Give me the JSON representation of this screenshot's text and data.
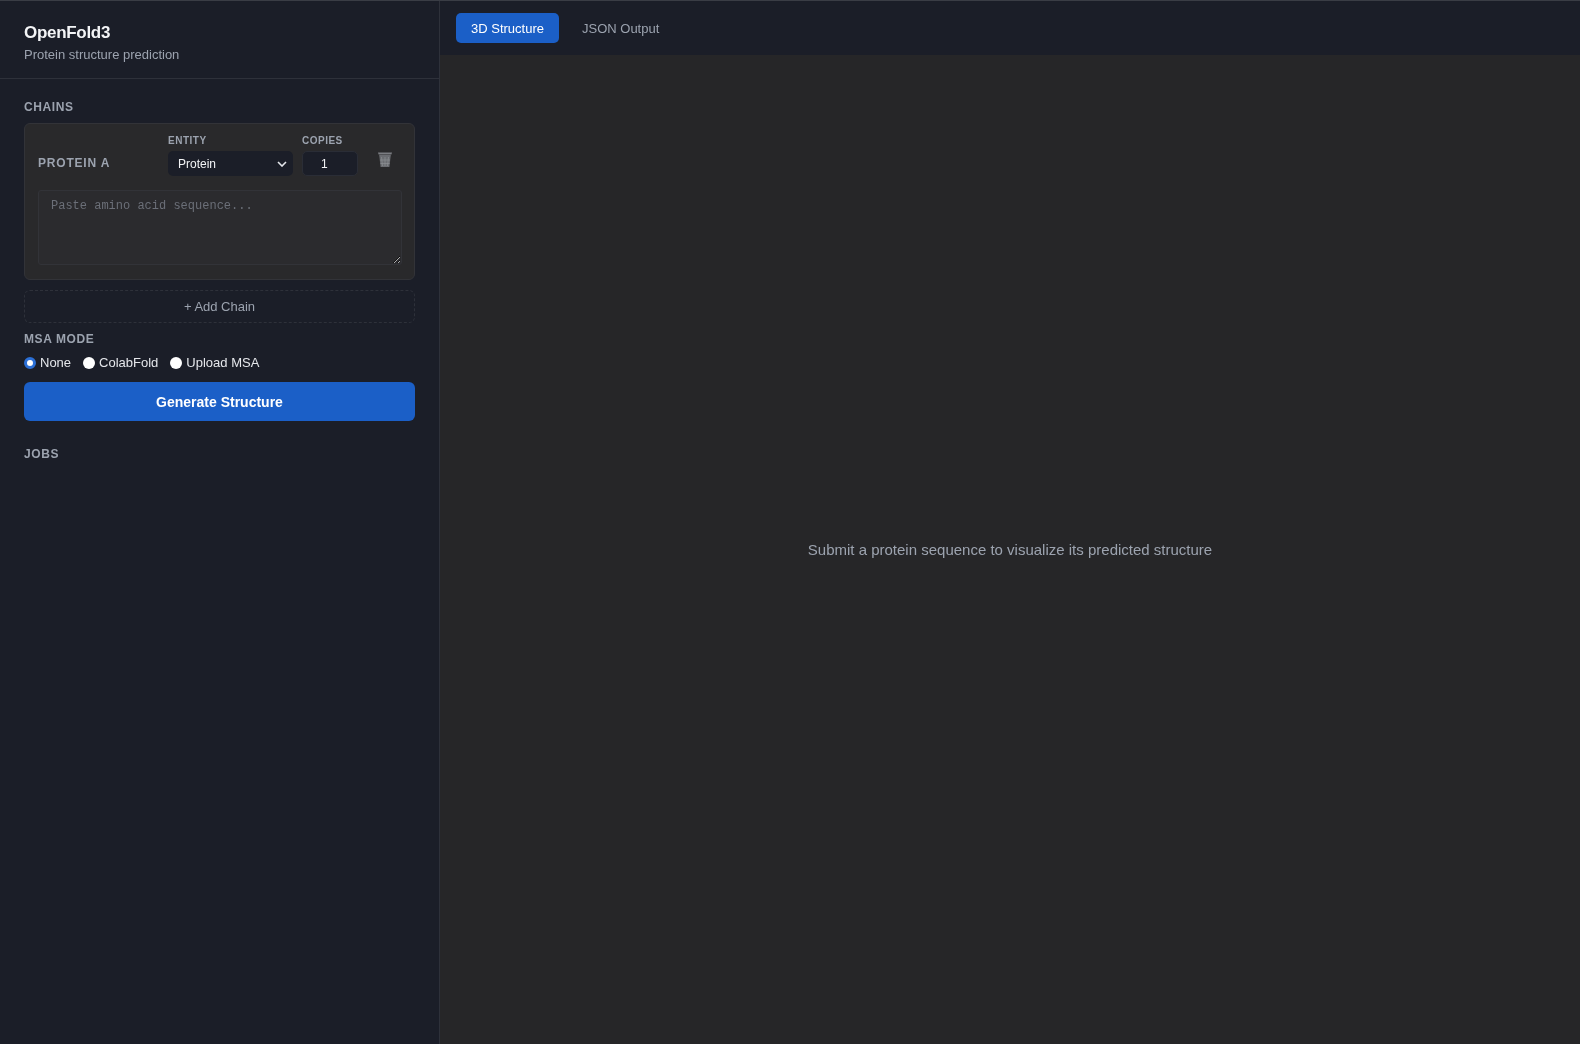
{
  "app": {
    "title": "OpenFold3",
    "subtitle": "Protein structure prediction"
  },
  "chains_section": {
    "heading": "CHAINS",
    "chains": [
      {
        "label": "PROTEIN A",
        "entity_label": "ENTITY",
        "entity_value": "Protein",
        "copies_label": "COPIES",
        "copies_value": "1",
        "sequence_placeholder": "Paste amino acid sequence..."
      }
    ],
    "add_button": "+ Add Chain"
  },
  "msa_mode": {
    "heading": "MSA MODE",
    "options": [
      {
        "label": "None",
        "selected": true
      },
      {
        "label": "ColabFold",
        "selected": false
      },
      {
        "label": "Upload MSA",
        "selected": false
      }
    ]
  },
  "generate_button": "Generate Structure",
  "jobs": {
    "heading": "JOBS"
  },
  "tabs": [
    {
      "label": "3D Structure",
      "selected": true
    },
    {
      "label": "JSON Output",
      "selected": false
    }
  ],
  "viewer": {
    "empty_message": "Submit a protein sequence to visualize its predicted structure"
  }
}
